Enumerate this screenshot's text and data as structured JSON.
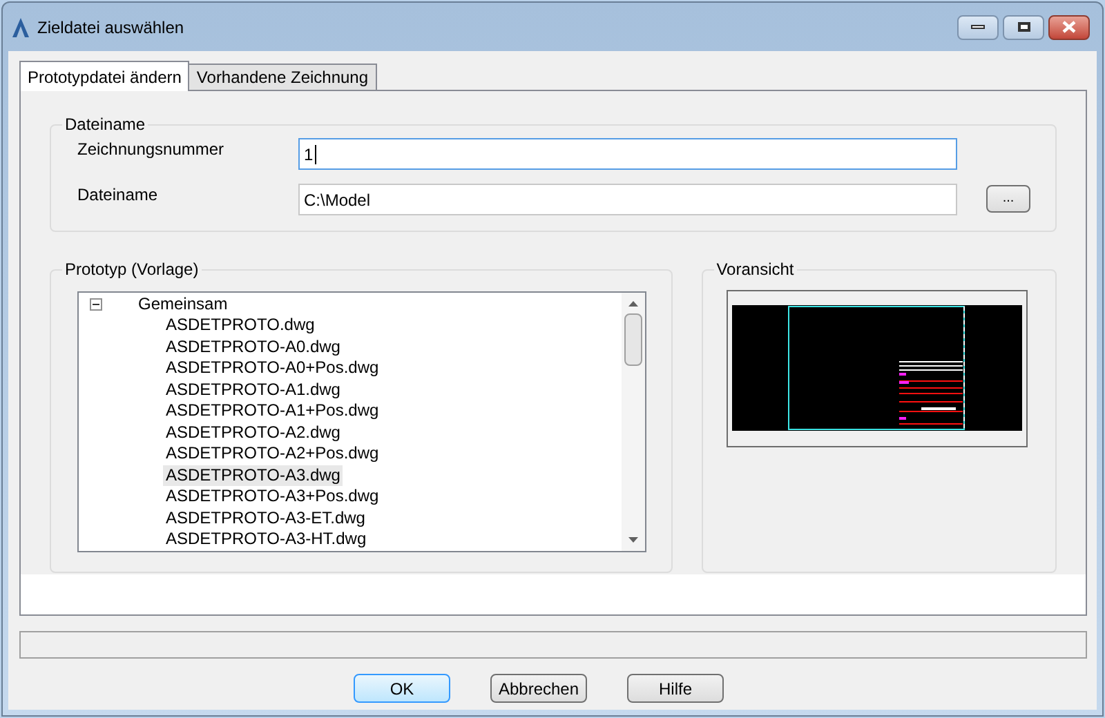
{
  "window": {
    "title": "Zieldatei auswählen"
  },
  "tabs": [
    {
      "label": "Prototypdatei ändern",
      "selected": true
    },
    {
      "label": "Vorhandene Zeichnung",
      "selected": false
    }
  ],
  "dateiname_group": {
    "title": "Dateiname",
    "fields": [
      {
        "label": "Zeichnungsnummer",
        "value": "1",
        "focused": true
      },
      {
        "label": "Dateiname",
        "value": "C:\\Model",
        "focused": false,
        "browse": "..."
      }
    ]
  },
  "prototype_group": {
    "title": "Prototyp (Vorlage)",
    "tree": [
      {
        "label": "Gemeinsam",
        "expanded": true,
        "children": [
          {
            "label": "ASDETPROTO.dwg",
            "selected": false
          },
          {
            "label": "ASDETPROTO-A0.dwg",
            "selected": false
          },
          {
            "label": "ASDETPROTO-A0+Pos.dwg",
            "selected": false
          },
          {
            "label": "ASDETPROTO-A1.dwg",
            "selected": false
          },
          {
            "label": "ASDETPROTO-A1+Pos.dwg",
            "selected": false
          },
          {
            "label": "ASDETPROTO-A2.dwg",
            "selected": false
          },
          {
            "label": "ASDETPROTO-A2+Pos.dwg",
            "selected": false
          },
          {
            "label": "ASDETPROTO-A3.dwg",
            "selected": true
          },
          {
            "label": "ASDETPROTO-A3+Pos.dwg",
            "selected": false
          },
          {
            "label": "ASDETPROTO-A3-ET.dwg",
            "selected": false
          },
          {
            "label": "ASDETPROTO-A3-HT.dwg",
            "selected": false
          }
        ]
      }
    ]
  },
  "preview_group": {
    "title": "Voransicht"
  },
  "buttons": [
    {
      "label": "OK",
      "default": true
    },
    {
      "label": "Abbrechen",
      "default": false
    },
    {
      "label": "Hilfe",
      "default": false
    }
  ]
}
